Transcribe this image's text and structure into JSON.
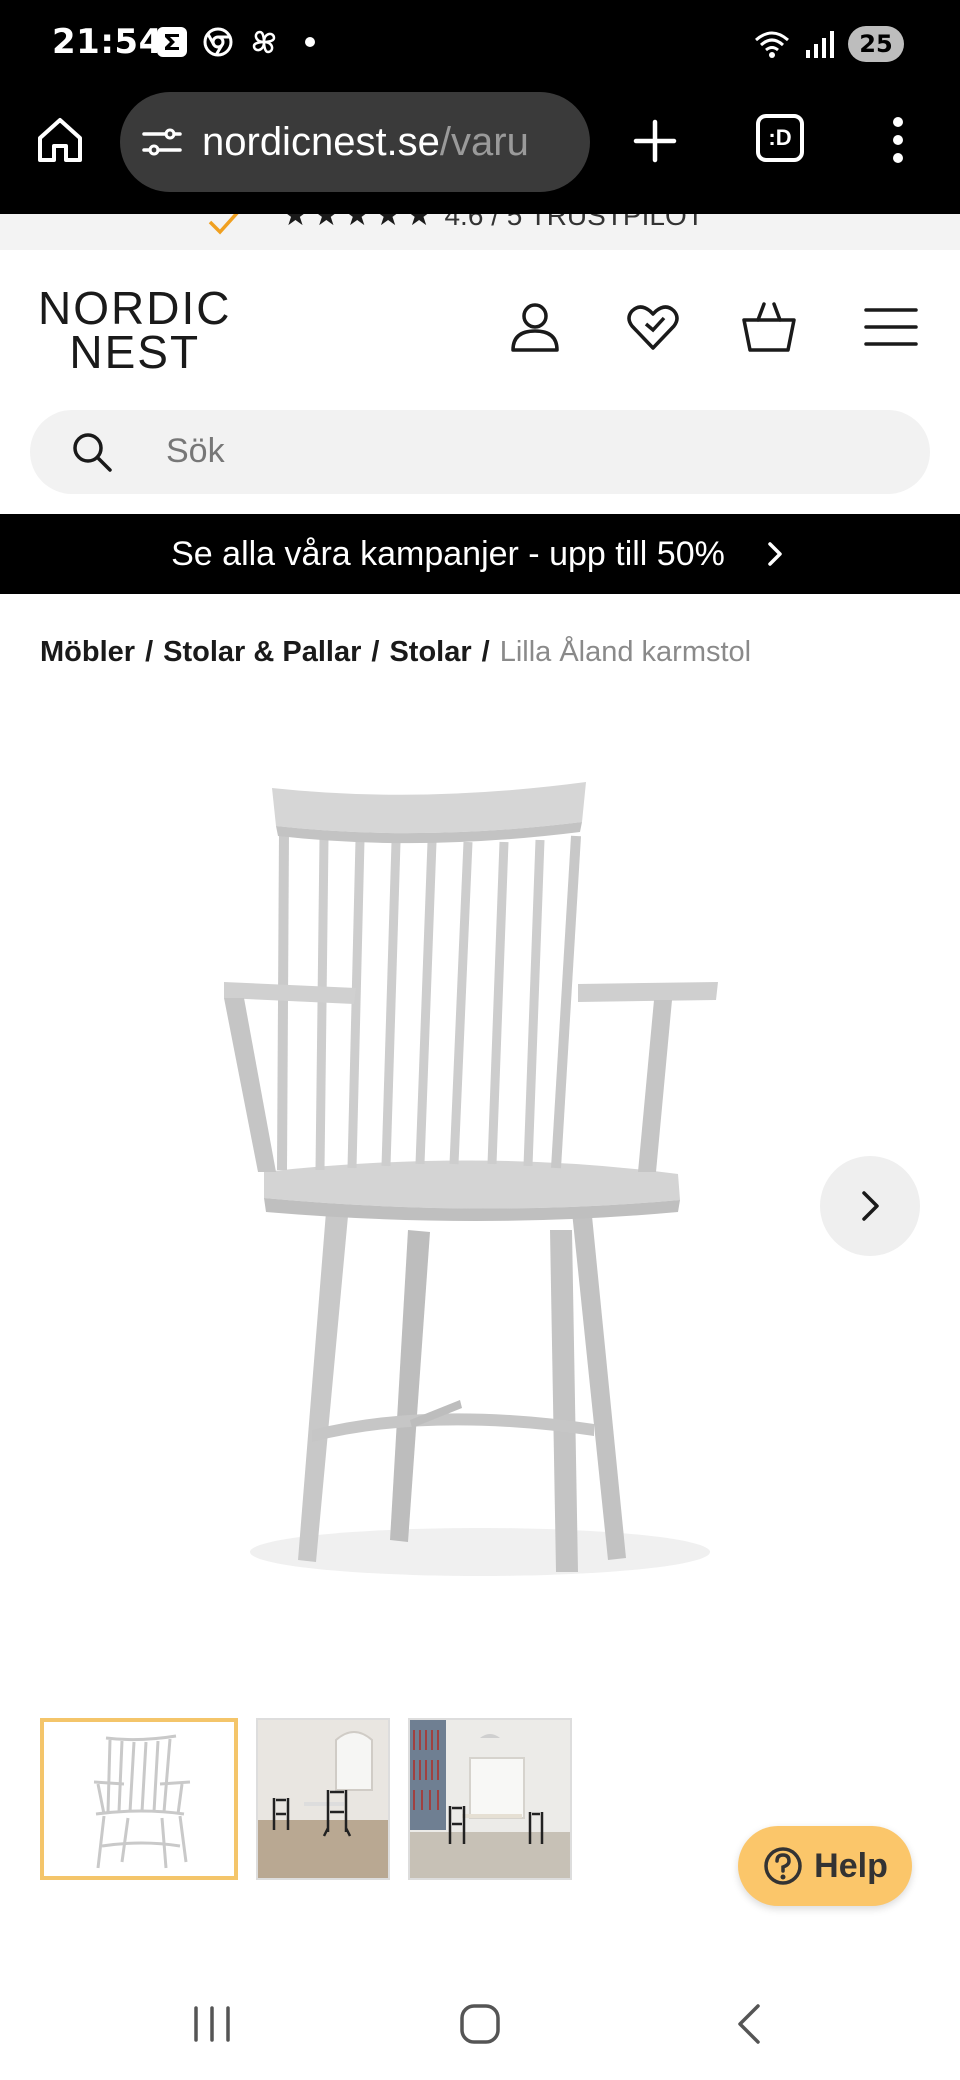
{
  "status_bar": {
    "time": "21:54",
    "battery": "25",
    "left_icons": [
      "sigma-icon",
      "chrome-icon",
      "pinwheel-icon",
      "dot-icon"
    ],
    "right_icons": [
      "wifi-icon",
      "signal-icon"
    ]
  },
  "browser": {
    "url_domain": "nordicnest.se",
    "url_path": "/varu",
    "tabs_label": ":D"
  },
  "trust": {
    "stars": "★★★★★",
    "rating_text": "4.6 / 5 TRUSTPILOT"
  },
  "header": {
    "logo_line1": "NORDIC",
    "logo_line2": "NEST"
  },
  "search": {
    "placeholder": "Sök"
  },
  "campaign": {
    "text": "Se alla våra kampanjer - upp till 50%"
  },
  "breadcrumb": {
    "items": [
      "Möbler",
      "Stolar & Pallar",
      "Stolar"
    ],
    "separator": "/",
    "current": "Lilla Åland karmstol"
  },
  "help": {
    "label": "Help"
  },
  "colors": {
    "accent": "#fbc66a",
    "thumb_active_border": "#f4c56a",
    "chair_gray": "#cfcfcf"
  }
}
